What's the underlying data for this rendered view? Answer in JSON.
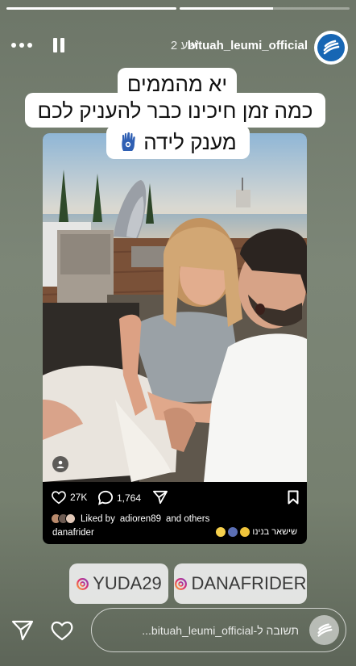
{
  "progress": [
    1.0,
    0.55
  ],
  "header": {
    "username": "bituah_leumi_official",
    "time_ago": "2 שע'"
  },
  "captions": {
    "line1": "יא מהממים",
    "line2": "כמה זמן חיכינו כבר להעניק לכם",
    "line3": "מענק לידה"
  },
  "post": {
    "likes": "27K",
    "comments": "1,764",
    "liked_by_prefix": "Liked by",
    "liked_by_user": "adioren89",
    "liked_by_suffix": "and others",
    "author": "danafrider",
    "comment_text": "שישאר בנינו"
  },
  "mentions": [
    "YUDA29",
    "DANAFRIDER"
  ],
  "reply": {
    "placeholder": "תשובה ל-bituah_leumi_official..."
  },
  "icons": [
    "more-icon",
    "pause-icon",
    "send-icon",
    "heart-icon",
    "comment-icon",
    "bookmark-icon",
    "user-tag-icon",
    "hamsa-icon",
    "instagram-icon"
  ],
  "colors": {
    "brand": "#1766b4",
    "story_bg": "#76806f"
  }
}
